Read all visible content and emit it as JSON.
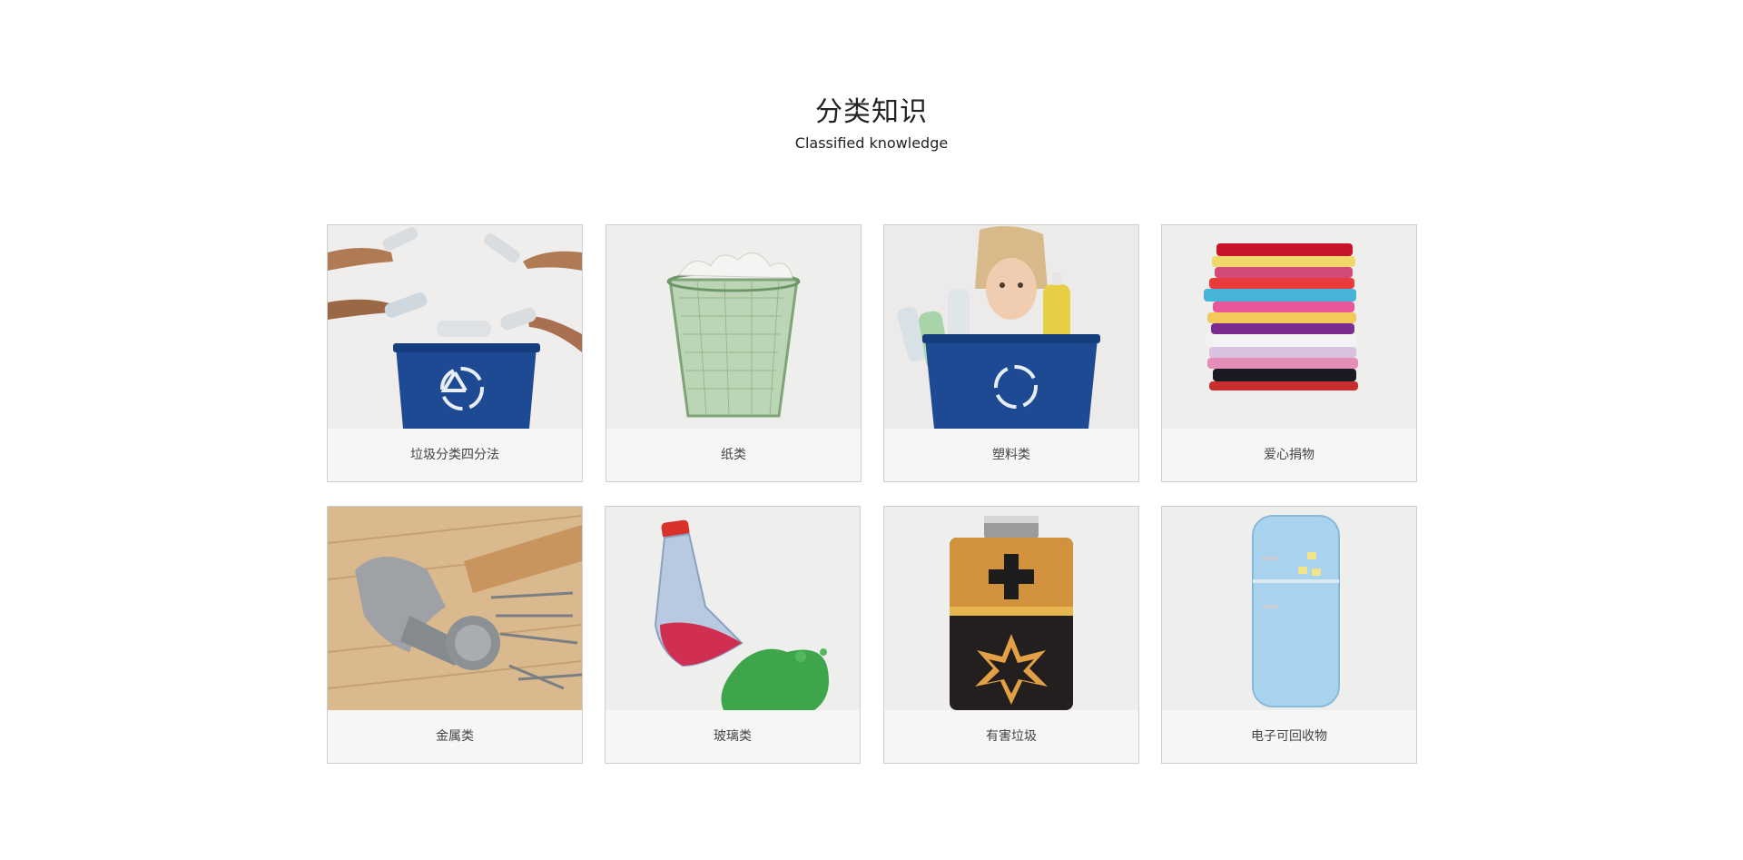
{
  "section": {
    "title": "分类知识",
    "subtitle": "Classified knowledge"
  },
  "categories": [
    {
      "label": "垃圾分类四分法",
      "icon": "recycling-hands-icon"
    },
    {
      "label": "纸类",
      "icon": "paper-bin-icon"
    },
    {
      "label": "塑料类",
      "icon": "plastic-bottles-icon"
    },
    {
      "label": "爱心捐物",
      "icon": "clothes-stack-icon"
    },
    {
      "label": "金属类",
      "icon": "hammer-nails-icon"
    },
    {
      "label": "玻璃类",
      "icon": "glass-bottle-icon"
    },
    {
      "label": "有害垃圾",
      "icon": "battery-icon"
    },
    {
      "label": "电子可回收物",
      "icon": "refrigerator-icon"
    }
  ],
  "colors": {
    "recycle_blue": "#1d4a93",
    "card_bg": "#f6f6f4",
    "border": "#cfcfcf"
  }
}
